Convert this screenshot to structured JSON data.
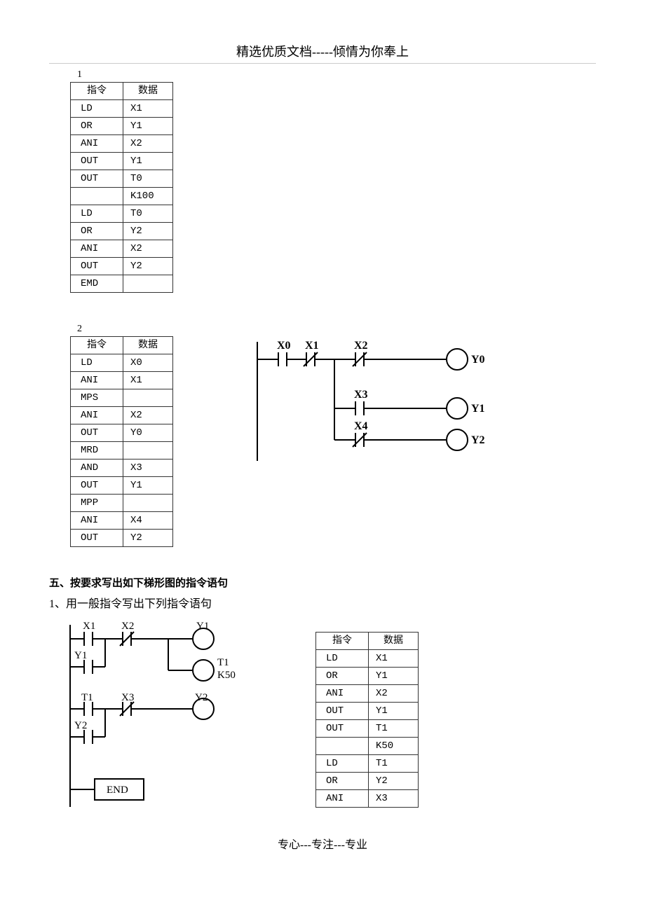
{
  "header": "精选优质文档-----倾情为你奉上",
  "footer": "专心---专注---专业",
  "tables": {
    "t1": {
      "label": "1",
      "headers": [
        "指令",
        "数据"
      ],
      "rows": [
        [
          "LD",
          "X1"
        ],
        [
          "OR",
          "Y1"
        ],
        [
          "ANI",
          "X2"
        ],
        [
          "OUT",
          "Y1"
        ],
        [
          "OUT",
          "T0"
        ],
        [
          "",
          "K100"
        ],
        [
          "LD",
          "T0"
        ],
        [
          "OR",
          "Y2"
        ],
        [
          "ANI",
          "X2"
        ],
        [
          "OUT",
          "Y2"
        ],
        [
          "EMD",
          ""
        ]
      ]
    },
    "t2": {
      "label": "2",
      "headers": [
        "指令",
        "数据"
      ],
      "rows": [
        [
          "LD",
          "X0"
        ],
        [
          "ANI",
          "X1"
        ],
        [
          "MPS",
          ""
        ],
        [
          "ANI",
          "X2"
        ],
        [
          "OUT",
          "Y0"
        ],
        [
          "MRD",
          ""
        ],
        [
          "AND",
          "X3"
        ],
        [
          "OUT",
          "Y1"
        ],
        [
          "MPP",
          ""
        ],
        [
          "ANI",
          "X4"
        ],
        [
          "OUT",
          "Y2"
        ]
      ]
    },
    "t3": {
      "headers": [
        "指令",
        "数据"
      ],
      "rows": [
        [
          "LD",
          "X1"
        ],
        [
          "OR",
          "Y1"
        ],
        [
          "ANI",
          "X2"
        ],
        [
          "OUT",
          "Y1"
        ],
        [
          "OUT",
          "T1"
        ],
        [
          "",
          "K50"
        ],
        [
          "LD",
          "T1"
        ],
        [
          "OR",
          "Y2"
        ],
        [
          "ANI",
          "X3"
        ]
      ]
    }
  },
  "section5": {
    "heading": "五、按要求写出如下梯形图的指令语句",
    "sub1": "1、用一般指令写出下列指令语句"
  },
  "ladder2_labels": {
    "x0": "X0",
    "x1": "X1",
    "x2": "X2",
    "x3": "X3",
    "x4": "X4",
    "y0": "Y0",
    "y1": "Y1",
    "y2": "Y2"
  },
  "ladder3_labels": {
    "x1": "X1",
    "x2": "X2",
    "y1": "Y1",
    "y1b": "Y1",
    "t1": "T1",
    "t1b": "T1",
    "k50": "K50",
    "x3": "X3",
    "y2": "Y2",
    "y2b": "Y2",
    "end": "END"
  }
}
